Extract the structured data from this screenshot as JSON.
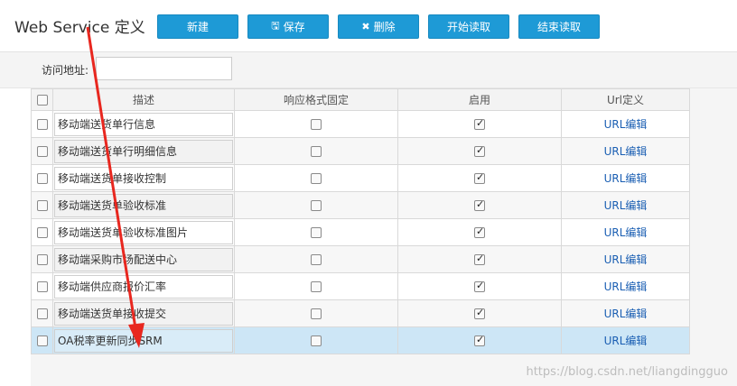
{
  "header": {
    "title": "Web Service 定义",
    "buttons": {
      "new": "新建",
      "save": "保存",
      "delete": "删除",
      "start_read": "开始读取",
      "end_read": "结束读取"
    }
  },
  "address": {
    "label": "访问地址:",
    "value": ""
  },
  "table": {
    "columns": [
      "描述",
      "响应格式固定",
      "启用",
      "Url定义"
    ],
    "rows": [
      {
        "desc": "移动端送货单行信息",
        "fixed": false,
        "enabled": true,
        "link": "URL编辑"
      },
      {
        "desc": "移动端送货单行明细信息",
        "fixed": false,
        "enabled": true,
        "link": "URL编辑"
      },
      {
        "desc": "移动端送货单接收控制",
        "fixed": false,
        "enabled": true,
        "link": "URL编辑"
      },
      {
        "desc": "移动端送货单验收标准",
        "fixed": false,
        "enabled": true,
        "link": "URL编辑"
      },
      {
        "desc": "移动端送货单验收标准图片",
        "fixed": false,
        "enabled": true,
        "link": "URL编辑"
      },
      {
        "desc": "移动端采购市场配送中心",
        "fixed": false,
        "enabled": true,
        "link": "URL编辑"
      },
      {
        "desc": "移动端供应商报价汇率",
        "fixed": false,
        "enabled": true,
        "link": "URL编辑"
      },
      {
        "desc": "移动端送货单接收提交",
        "fixed": false,
        "enabled": true,
        "link": "URL编辑"
      },
      {
        "desc": "OA税率更新同步SRM",
        "fixed": false,
        "enabled": true,
        "link": "URL编辑"
      }
    ]
  },
  "watermark": "https://blog.csdn.net/liangdingguo",
  "colors": {
    "button": "#1e9ad6",
    "selected_row": "#cde6f6",
    "link": "#1b5fb3",
    "arrow": "#e8271f"
  }
}
